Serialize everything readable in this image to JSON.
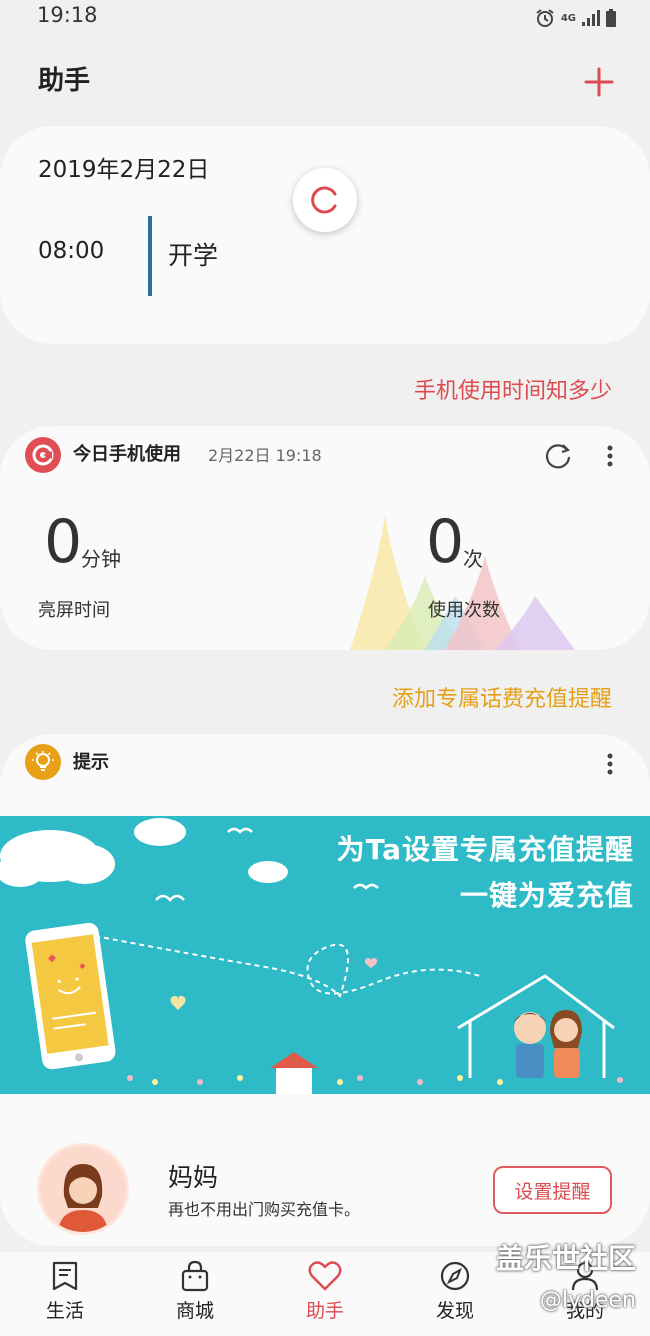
{
  "status_bar": {
    "time": "19:18",
    "network": "4G"
  },
  "header": {
    "title": "助手",
    "add_icon": "plus-icon"
  },
  "schedule": {
    "date": "2019年2月22日",
    "time": "08:00",
    "event": "开学"
  },
  "links": {
    "phone_usage": "手机使用时间知多少",
    "recharge": "添加专属话费充值提醒"
  },
  "usage": {
    "title": "今日手机使用",
    "timestamp": "2月22日 19:18",
    "screen_time_value": "0",
    "screen_time_unit": "分钟",
    "screen_time_label": "亮屏时间",
    "use_count_value": "0",
    "use_count_unit": "次",
    "use_count_label": "使用次数"
  },
  "tips": {
    "title": "提示",
    "banner_line1": "为Ta设置专属充值提醒",
    "banner_line2": "一键为爱充值",
    "contact_name": "妈妈",
    "contact_desc": "再也不用出门购买充值卡。",
    "button": "设置提醒"
  },
  "nav": {
    "items": [
      {
        "label": "生活",
        "icon": "bookmark-icon"
      },
      {
        "label": "商城",
        "icon": "shopping-bag-icon"
      },
      {
        "label": "助手",
        "icon": "heart-icon",
        "active": true
      },
      {
        "label": "发现",
        "icon": "compass-icon"
      },
      {
        "label": "我的",
        "icon": "person-icon"
      }
    ]
  },
  "watermark": {
    "line1": "盖乐世社区",
    "line2": "@lydeen"
  },
  "colors": {
    "accent": "#dc4b4f",
    "orange": "#e6a017",
    "banner": "#2ebac7",
    "schedule_bar": "#2a6f96"
  }
}
